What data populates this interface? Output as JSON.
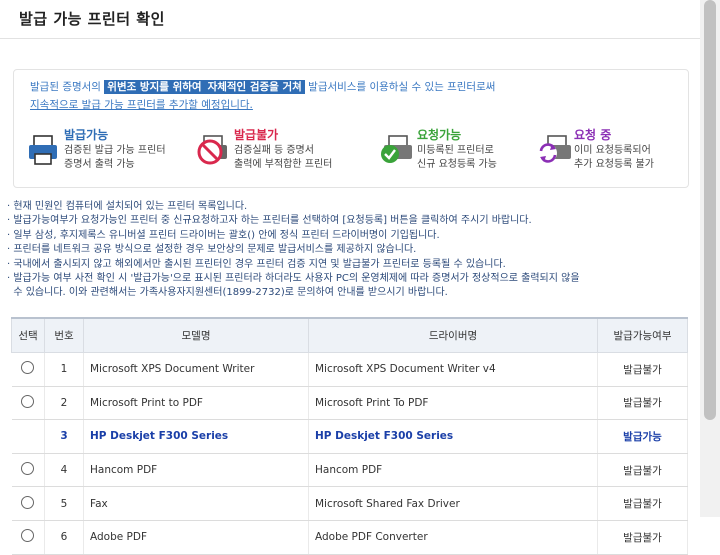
{
  "page": {
    "title": "발급 가능 프린터 확인"
  },
  "intro": {
    "part1": "발급된 증명서의 ",
    "hl1": "위변조 방지를 위하여",
    "hl2": "자체적인 검증을 거쳐",
    "part2": " 발급서비스를 이용하실 수 있는 프린터로써",
    "line2": "지속적으로 발급 가능 프린터를 추가할 예정입니다."
  },
  "legend": [
    {
      "title": "발급가능",
      "color": "#2f6db5",
      "desc1": "검증된 발급 가능 프린터",
      "desc2": "증명서 출력 가능",
      "icon": "printer-ok-icon"
    },
    {
      "title": "발급불가",
      "color": "#d9284d",
      "desc1": "검증실패 등 증명서",
      "desc2": "출력에 부적합한 프린터",
      "icon": "printer-blocked-icon"
    },
    {
      "title": "요청가능",
      "color": "#3aa33a",
      "desc1": "미등록된 프린터로",
      "desc2": "신규 요청등록 가능",
      "icon": "printer-request-icon"
    },
    {
      "title": "요청 중",
      "color": "#8b2fb5",
      "desc1": "이미 요청등록되어",
      "desc2": "추가 요청등록 불가",
      "icon": "printer-pending-icon"
    }
  ],
  "notes": [
    "· 현재 민원인 컴퓨터에 설치되어 있는 프린터 목록입니다.",
    "· 발급가능여부가 요청가능인 프린터 중 신규요청하고자 하는 프린터를 선택하여 [요청등록] 버튼을 클릭하여 주시기 바랍니다.",
    "· 일부 삼성, 후지제록스 유니버셜 프린터 드라이버는 괄호() 안에 정식 프린터 드라이버명이 기입됩니다.",
    "· 프린터를 네트워크 공유 방식으로 설정한 경우 보안상의 문제로 발급서비스를 제공하지 않습니다.",
    "· 국내에서 출시되지 않고 해외에서만 출시된 프린터인 경우 프린터 검증 지연 및 발급불가 프린터로 등록될 수 있습니다.",
    "· 발급가능 여부 사전 확인 시 '발급가능'으로 표시된 프린터라 하더라도 사용자 PC의 운영체제에 따라 증명서가 정상적으로 출력되지 않을",
    "  수 있습니다. 이와 관련해서는 가족사용자지원센터(1899-2732)로 문의하여 안내를 받으시기 바랍니다."
  ],
  "table": {
    "headers": [
      "선택",
      "번호",
      "모델명",
      "드라이버명",
      "발급가능여부"
    ],
    "rows": [
      {
        "no": "1",
        "model": "Microsoft XPS Document Writer",
        "driver": "Microsoft XPS Document Writer v4",
        "status": "발급불가",
        "selected": false
      },
      {
        "no": "2",
        "model": "Microsoft Print to PDF",
        "driver": "Microsoft Print To PDF",
        "status": "발급불가",
        "selected": false
      },
      {
        "no": "3",
        "model": "HP Deskjet F300 Series",
        "driver": "HP Deskjet F300 Series",
        "status": "발급가능",
        "selected": true
      },
      {
        "no": "4",
        "model": "Hancom PDF",
        "driver": "Hancom PDF",
        "status": "발급불가",
        "selected": false
      },
      {
        "no": "5",
        "model": "Fax",
        "driver": "Microsoft Shared Fax Driver",
        "status": "발급불가",
        "selected": false
      },
      {
        "no": "6",
        "model": "Adobe PDF",
        "driver": "Adobe PDF Converter",
        "status": "발급불가",
        "selected": false
      }
    ]
  }
}
